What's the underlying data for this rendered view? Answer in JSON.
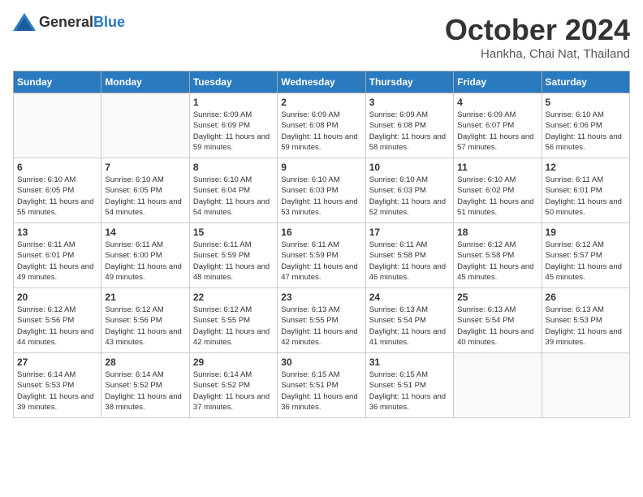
{
  "logo": {
    "general": "General",
    "blue": "Blue"
  },
  "title": "October 2024",
  "location": "Hankha, Chai Nat, Thailand",
  "weekdays": [
    "Sunday",
    "Monday",
    "Tuesday",
    "Wednesday",
    "Thursday",
    "Friday",
    "Saturday"
  ],
  "weeks": [
    [
      {
        "day": "",
        "empty": true
      },
      {
        "day": "",
        "empty": true
      },
      {
        "day": "1",
        "sunrise": "6:09 AM",
        "sunset": "6:09 PM",
        "daylight": "11 hours and 59 minutes."
      },
      {
        "day": "2",
        "sunrise": "6:09 AM",
        "sunset": "6:08 PM",
        "daylight": "11 hours and 59 minutes."
      },
      {
        "day": "3",
        "sunrise": "6:09 AM",
        "sunset": "6:08 PM",
        "daylight": "11 hours and 58 minutes."
      },
      {
        "day": "4",
        "sunrise": "6:09 AM",
        "sunset": "6:07 PM",
        "daylight": "11 hours and 57 minutes."
      },
      {
        "day": "5",
        "sunrise": "6:10 AM",
        "sunset": "6:06 PM",
        "daylight": "11 hours and 56 minutes."
      }
    ],
    [
      {
        "day": "6",
        "sunrise": "6:10 AM",
        "sunset": "6:05 PM",
        "daylight": "11 hours and 55 minutes."
      },
      {
        "day": "7",
        "sunrise": "6:10 AM",
        "sunset": "6:05 PM",
        "daylight": "11 hours and 54 minutes."
      },
      {
        "day": "8",
        "sunrise": "6:10 AM",
        "sunset": "6:04 PM",
        "daylight": "11 hours and 54 minutes."
      },
      {
        "day": "9",
        "sunrise": "6:10 AM",
        "sunset": "6:03 PM",
        "daylight": "11 hours and 53 minutes."
      },
      {
        "day": "10",
        "sunrise": "6:10 AM",
        "sunset": "6:03 PM",
        "daylight": "11 hours and 52 minutes."
      },
      {
        "day": "11",
        "sunrise": "6:10 AM",
        "sunset": "6:02 PM",
        "daylight": "11 hours and 51 minutes."
      },
      {
        "day": "12",
        "sunrise": "6:11 AM",
        "sunset": "6:01 PM",
        "daylight": "11 hours and 50 minutes."
      }
    ],
    [
      {
        "day": "13",
        "sunrise": "6:11 AM",
        "sunset": "6:01 PM",
        "daylight": "11 hours and 49 minutes."
      },
      {
        "day": "14",
        "sunrise": "6:11 AM",
        "sunset": "6:00 PM",
        "daylight": "11 hours and 49 minutes."
      },
      {
        "day": "15",
        "sunrise": "6:11 AM",
        "sunset": "5:59 PM",
        "daylight": "11 hours and 48 minutes."
      },
      {
        "day": "16",
        "sunrise": "6:11 AM",
        "sunset": "5:59 PM",
        "daylight": "11 hours and 47 minutes."
      },
      {
        "day": "17",
        "sunrise": "6:11 AM",
        "sunset": "5:58 PM",
        "daylight": "11 hours and 46 minutes."
      },
      {
        "day": "18",
        "sunrise": "6:12 AM",
        "sunset": "5:58 PM",
        "daylight": "11 hours and 45 minutes."
      },
      {
        "day": "19",
        "sunrise": "6:12 AM",
        "sunset": "5:57 PM",
        "daylight": "11 hours and 45 minutes."
      }
    ],
    [
      {
        "day": "20",
        "sunrise": "6:12 AM",
        "sunset": "5:56 PM",
        "daylight": "11 hours and 44 minutes."
      },
      {
        "day": "21",
        "sunrise": "6:12 AM",
        "sunset": "5:56 PM",
        "daylight": "11 hours and 43 minutes."
      },
      {
        "day": "22",
        "sunrise": "6:12 AM",
        "sunset": "5:55 PM",
        "daylight": "11 hours and 42 minutes."
      },
      {
        "day": "23",
        "sunrise": "6:13 AM",
        "sunset": "5:55 PM",
        "daylight": "11 hours and 42 minutes."
      },
      {
        "day": "24",
        "sunrise": "6:13 AM",
        "sunset": "5:54 PM",
        "daylight": "11 hours and 41 minutes."
      },
      {
        "day": "25",
        "sunrise": "6:13 AM",
        "sunset": "5:54 PM",
        "daylight": "11 hours and 40 minutes."
      },
      {
        "day": "26",
        "sunrise": "6:13 AM",
        "sunset": "5:53 PM",
        "daylight": "11 hours and 39 minutes."
      }
    ],
    [
      {
        "day": "27",
        "sunrise": "6:14 AM",
        "sunset": "5:53 PM",
        "daylight": "11 hours and 39 minutes."
      },
      {
        "day": "28",
        "sunrise": "6:14 AM",
        "sunset": "5:52 PM",
        "daylight": "11 hours and 38 minutes."
      },
      {
        "day": "29",
        "sunrise": "6:14 AM",
        "sunset": "5:52 PM",
        "daylight": "11 hours and 37 minutes."
      },
      {
        "day": "30",
        "sunrise": "6:15 AM",
        "sunset": "5:51 PM",
        "daylight": "11 hours and 36 minutes."
      },
      {
        "day": "31",
        "sunrise": "6:15 AM",
        "sunset": "5:51 PM",
        "daylight": "11 hours and 36 minutes."
      },
      {
        "day": "",
        "empty": true
      },
      {
        "day": "",
        "empty": true
      }
    ]
  ]
}
